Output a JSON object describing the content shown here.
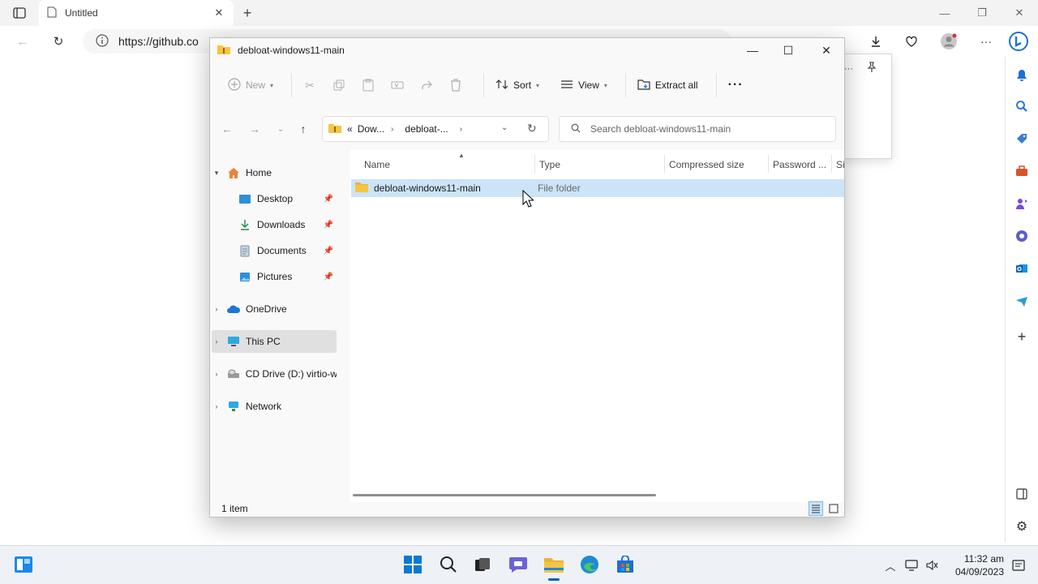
{
  "browser": {
    "tab_title": "Untitled",
    "url": "https://github.com/...",
    "url_visible": "https://github.co"
  },
  "explorer": {
    "title": "debloat-windows11-main",
    "toolbar": {
      "new_label": "New",
      "sort_label": "Sort",
      "view_label": "View",
      "extract_label": "Extract all",
      "more_label": "···"
    },
    "breadcrumb": {
      "overflow": "«",
      "items": [
        "Dow...",
        "debloat-..."
      ]
    },
    "search_placeholder": "Search debloat-windows11-main",
    "nav": {
      "home": "Home",
      "desktop": "Desktop",
      "downloads": "Downloads",
      "documents": "Documents",
      "pictures": "Pictures",
      "onedrive": "OneDrive",
      "thispc": "This PC",
      "cddrive": "CD Drive (D:) virtio-w",
      "network": "Network"
    },
    "columns": {
      "name": "Name",
      "type": "Type",
      "compressed": "Compressed size",
      "password": "Password ...",
      "size": "Si"
    },
    "rows": [
      {
        "name": "debloat-windows11-main",
        "type": "File folder"
      }
    ],
    "status": "1 item"
  },
  "taskbar": {
    "time": "11:32 am",
    "date": "04/09/2023"
  },
  "colors": {
    "accent": "#005fb8",
    "selection": "#cce4f7",
    "folder": "#f5c542"
  }
}
